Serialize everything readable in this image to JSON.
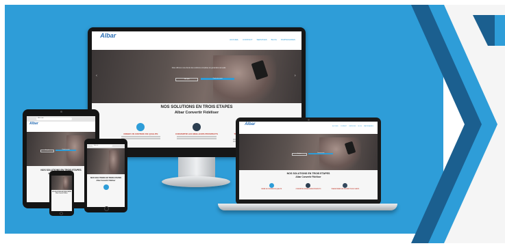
{
  "brand": {
    "logo_text": "Albar"
  },
  "nav": [
    "ACCUEIL",
    "CONTACT",
    "SERVICES",
    "BLOG",
    "PARTENAIRES"
  ],
  "hero": {
    "tagline": "Nous offrons à nos clients des solutions complètes de génération de leads",
    "button_primary": "Voir plus",
    "button_secondary": "Contactez-nous"
  },
  "section": {
    "title": "NOS SOLUTIONS EN TROIS ETAPES",
    "subtitle": "Albar Convertir Fidéliser"
  },
  "steps": [
    {
      "title": "CREER UN CONTENU DE QUALITE",
      "icon": "chart-icon"
    },
    {
      "title": "CONVERTIR LES MEILLEURS PROSPECTS",
      "icon": "person-icon"
    },
    {
      "title": "TRANSFORMER LES PROSPECTS EN CLIENTS",
      "icon": "handshake-icon"
    }
  ],
  "browser": {
    "url": "albar.com"
  },
  "colors": {
    "background_blue": "#2e9dd8",
    "chevron_dark": "#1b5f8f",
    "accent_red": "#c0392b",
    "logo_blue": "#2b6fb5"
  }
}
